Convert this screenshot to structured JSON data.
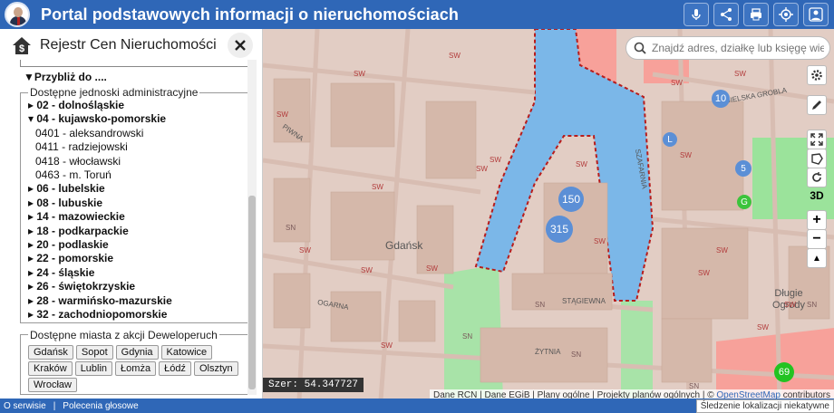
{
  "app": {
    "title": "Portal podstawowych informacji o nieruchomościach"
  },
  "topbar": {
    "icons": [
      "microphone-icon",
      "share-icon",
      "print-icon",
      "locate-icon",
      "user-icon"
    ]
  },
  "panel": {
    "title": "Rejestr Cen Nieruchomości",
    "zoom_to": "▼Przybliż do ....",
    "units_legend": "Dostępne jednoski administracyjne",
    "units": [
      {
        "label": "▸ 02 - dolnośląskie",
        "bold": true
      },
      {
        "label": "▾ 04 - kujawsko-pomorskie",
        "bold": true
      },
      {
        "label": "0401 - aleksandrowski",
        "bold": false
      },
      {
        "label": "0411 - radziejowski",
        "bold": false
      },
      {
        "label": "0418 - włocławski",
        "bold": false
      },
      {
        "label": "0463 - m. Toruń",
        "bold": false
      },
      {
        "label": "▸ 06 - lubelskie",
        "bold": true
      },
      {
        "label": "▸ 08 - lubuskie",
        "bold": true
      },
      {
        "label": "▸ 14 - mazowieckie",
        "bold": true
      },
      {
        "label": "▸ 18 - podkarpackie",
        "bold": true
      },
      {
        "label": "▸ 20 - podlaskie",
        "bold": true
      },
      {
        "label": "▸ 22 - pomorskie",
        "bold": true
      },
      {
        "label": "▸ 24 - śląskie",
        "bold": true
      },
      {
        "label": "▸ 26 - świętokrzyskie",
        "bold": true
      },
      {
        "label": "▸ 28 - warmińsko-mazurskie",
        "bold": true
      },
      {
        "label": "▸ 32 - zachodniopomorskie",
        "bold": true
      }
    ],
    "cities_legend": "Dostępne miasta z akcji Deweloperuch",
    "cities": [
      "Gdańsk",
      "Sopot",
      "Gdynia",
      "Katowice",
      "Kraków",
      "Lublin",
      "Łomża",
      "Łódź",
      "Olsztyn",
      "Wrocław"
    ]
  },
  "map": {
    "search_placeholder": "Znajdź adres, działkę lub księgę wieczystą",
    "tools": [
      "settings-icon",
      "draw-icon",
      "fullscreen-icon",
      "polygon-icon",
      "rotate-icon"
    ],
    "three_d": "3D",
    "zoom_in": "+",
    "zoom_out": "−",
    "compass": "▲",
    "clusters": [
      {
        "value": "150",
        "color": "#5b8fd6"
      },
      {
        "value": "315",
        "color": "#5b8fd6"
      },
      {
        "value": "10",
        "color": "#5b8fd6"
      },
      {
        "value": "L",
        "color": "#5b8fd6"
      },
      {
        "value": "5",
        "color": "#5b8fd6"
      },
      {
        "value": "G",
        "color": "#3cc43c"
      },
      {
        "value": "69",
        "color": "#22c322"
      }
    ],
    "labels": [
      "Gdańsk",
      "Długie Ogrody",
      "ANGIELSKA GROBLA",
      "STĄGIEWNA",
      "PIWNA",
      "OGARNA",
      "ŻYTNIA",
      "SZAFARNIA"
    ],
    "sw_tag": "SW",
    "sn_tag": "SN",
    "coord": "Szer: 54.347727",
    "attribution": {
      "text": "Dane RCN | Dane EGiB | Plany ogólne | Projekty planów ogólnych | © ",
      "link": "OpenStreetMap",
      "suffix": " contributors"
    }
  },
  "footer": {
    "service": "O serwisie",
    "voice": "Polecenia głosowe",
    "accuracy": "Śledzenie lokalizacji niekatywne"
  }
}
